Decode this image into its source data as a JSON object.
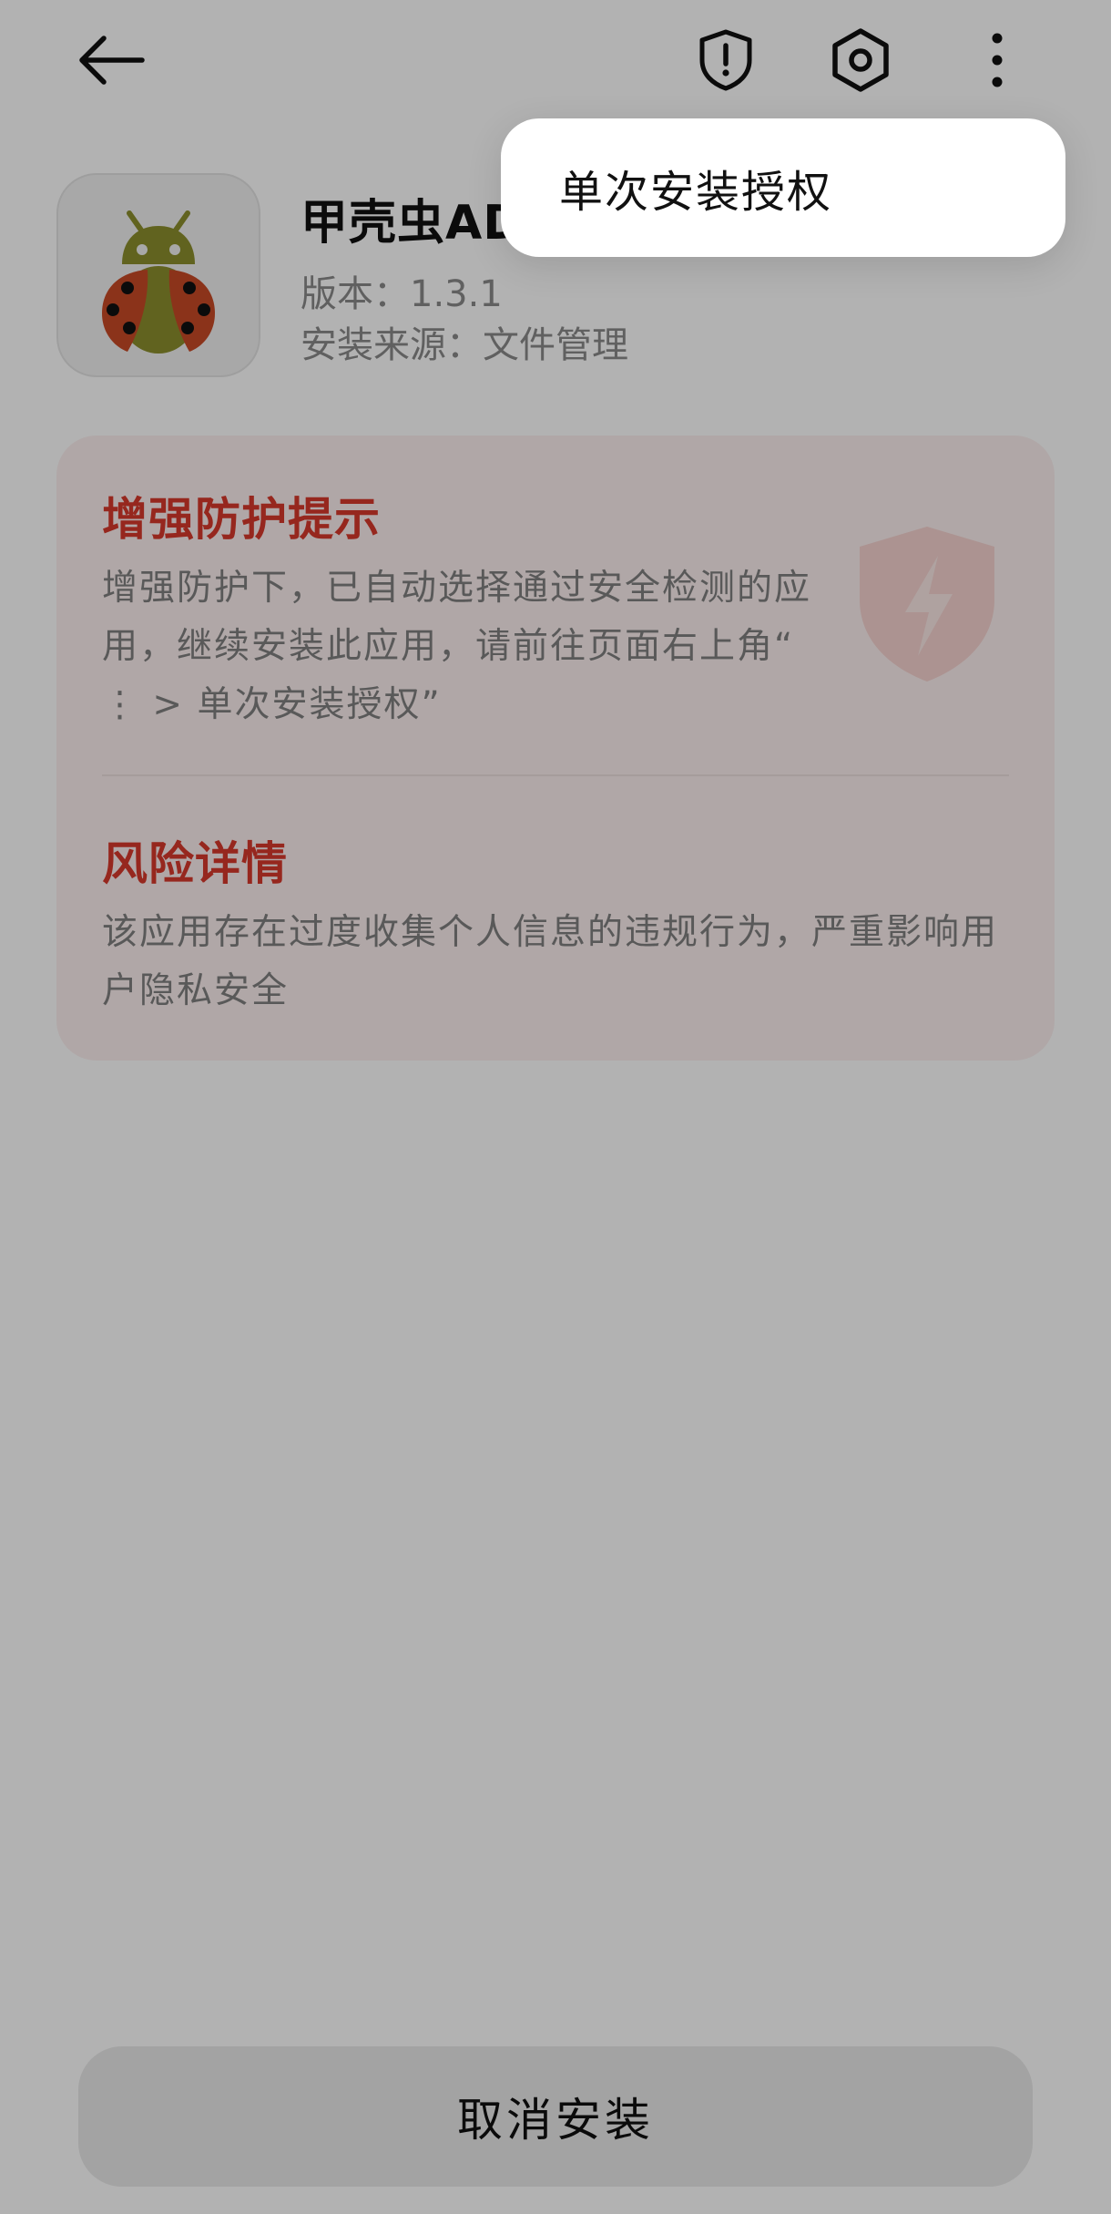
{
  "topbar": {
    "back_icon": "arrow-left-icon",
    "shield_icon": "shield-exclamation-icon",
    "settings_icon": "hexagon-gear-icon",
    "more_icon": "more-vertical-icon"
  },
  "app": {
    "name": "甲壳虫ADB",
    "version": "版本：1.3.1",
    "source": "安装来源：文件管理",
    "icon": "ladybug-android-icon"
  },
  "card": {
    "protect_title": "增强防护提示",
    "protect_body": "增强防护下，已自动选择通过安全检测的应用，继续安装此应用，请前往页面右上角“ ⋮ > 单次安装授权”",
    "risk_title": "风险详情",
    "risk_body": "该应用存在过度收集个人信息的违规行为，严重影响用户隐私安全",
    "watermark_icon": "shield-lightning-icon"
  },
  "bottom": {
    "cancel_label": "取消安装"
  },
  "popup": {
    "items": [
      {
        "label": "单次安装授权"
      }
    ]
  },
  "colors": {
    "accent_red": "#d7392c",
    "card_bg": "#fdf0ef",
    "scrim": "rgba(0,0,0,0.30)"
  }
}
